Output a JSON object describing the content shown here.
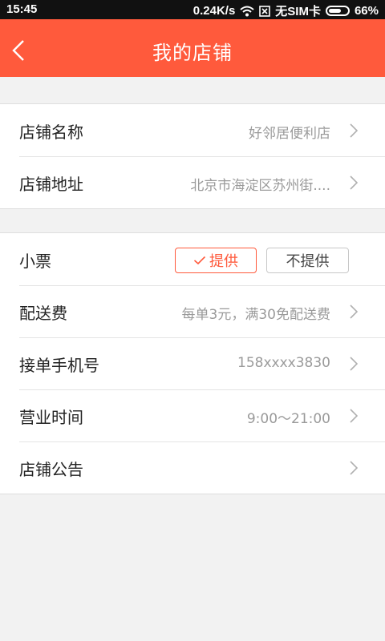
{
  "status_bar": {
    "time": "15:45",
    "speed": "0.24K/s",
    "sim": "无SIM卡",
    "battery": "66%",
    "battery_level": 0.66
  },
  "header": {
    "title": "我的店铺",
    "background": "#ff5a3c"
  },
  "store_group": [
    {
      "label": "店铺名称",
      "value": "好邻居便利店"
    },
    {
      "label": "店铺地址",
      "value": "北京市海淀区苏州街...."
    }
  ],
  "receipt": {
    "label": "小票",
    "provide": "提供",
    "not_provide": "不提供",
    "selected": "提供"
  },
  "settings_group": [
    {
      "label": "配送费",
      "value": "每单3元，满30免配送费"
    },
    {
      "label": "接单手机号",
      "value": "158xxxx3830"
    },
    {
      "label": "营业时间",
      "value": "9:00～21:00"
    },
    {
      "label": "店铺公告",
      "value": ""
    }
  ]
}
